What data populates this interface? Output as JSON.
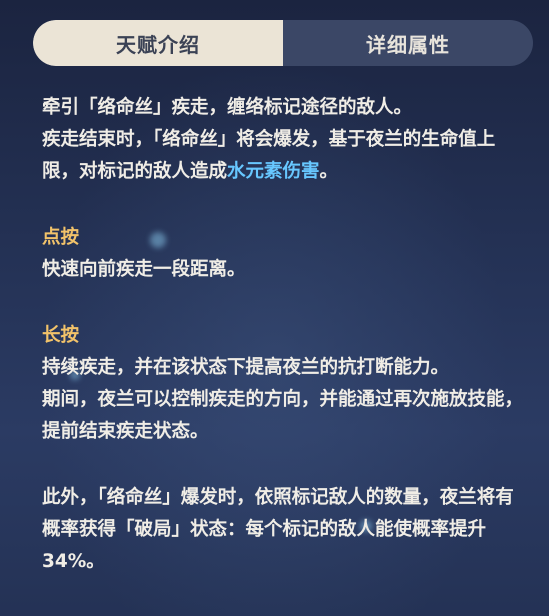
{
  "tabs": [
    {
      "label": "天赋介绍",
      "active": true
    },
    {
      "label": "详细属性",
      "active": false
    }
  ],
  "intro": {
    "line1": "牵引「络命丝」疾走，缠络标记途径的敌人。",
    "line2_pre": "疾走结束时，「络命丝」将会爆发，基于夜兰的生命值上限，对标记的敌人造成",
    "line2_highlight": "水元素伤害",
    "line2_post": "。"
  },
  "tap": {
    "heading": "点按",
    "text": "快速向前疾走一段距离。"
  },
  "hold": {
    "heading": "长按",
    "text1": "持续疾走，并在该状态下提高夜兰的抗打断能力。",
    "text2": "期间，夜兰可以控制疾走的方向，并能通过再次施放技能，提前结束疾走状态。"
  },
  "extra": {
    "text": "此外，「络命丝」爆发时，依照标记敌人的数量，夜兰将有概率获得「破局」状态：每个标记的敌人能使概率提升34%。"
  },
  "colors": {
    "heading": "#f2c36a",
    "hydro": "#67c7ff",
    "text": "#f0ede6",
    "tab_active_bg": "#ebe4d6"
  }
}
